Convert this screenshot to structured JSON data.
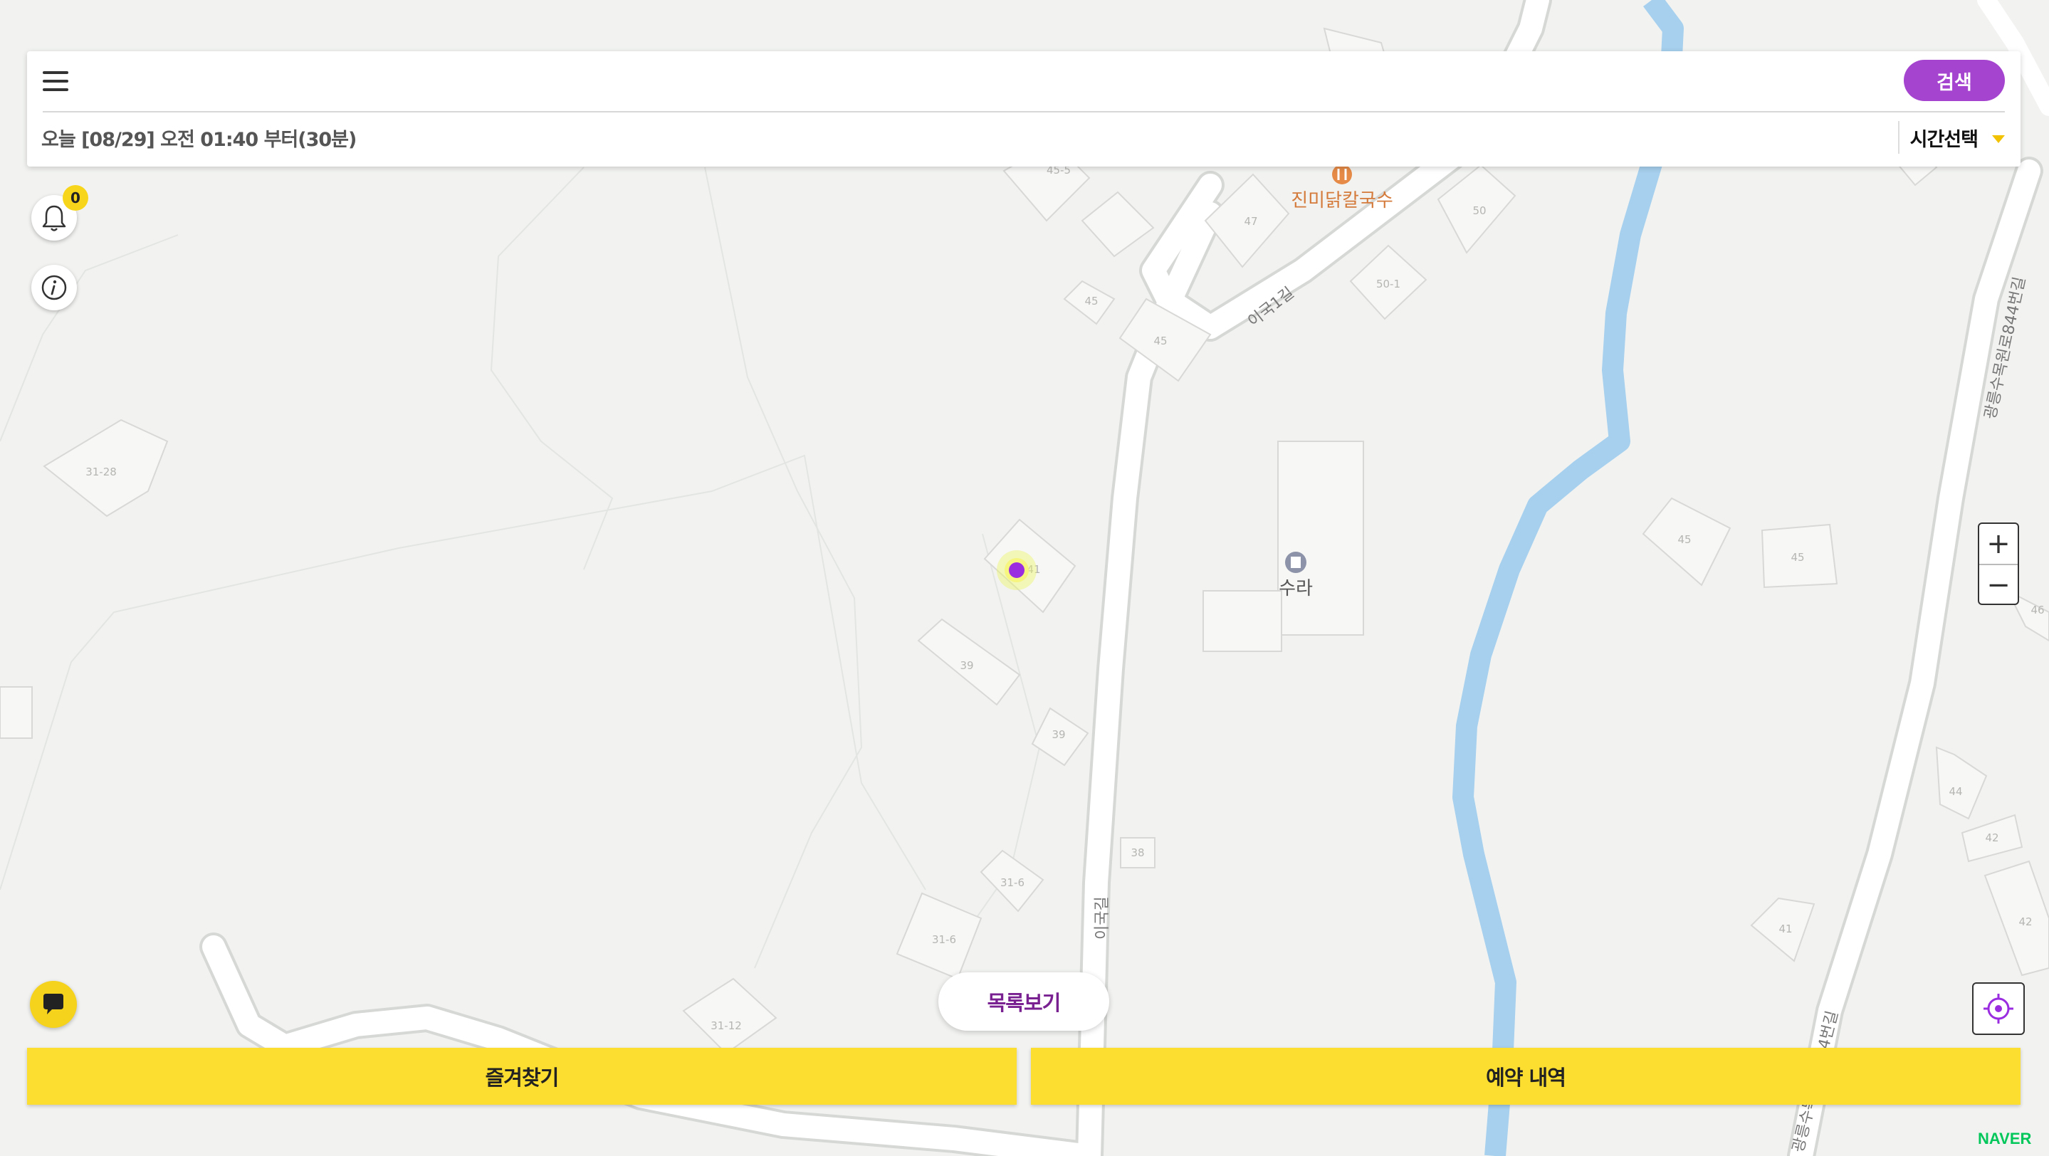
{
  "header": {
    "search_label": "검색",
    "time_text": "오늘 [08/29] 오전 01:40 부터(30분)",
    "time_select_label": "시간선택"
  },
  "notifications": {
    "count": "0"
  },
  "map": {
    "pois": [
      {
        "name": "진미닭칼국수",
        "icon": "restaurant-icon"
      },
      {
        "name": "수라",
        "icon": "building-icon"
      }
    ],
    "roads": [
      "이국1길",
      "이국길",
      "광릉수목원로844번길",
      "광릉수목원로844번길"
    ],
    "building_numbers": [
      "45-5",
      "47",
      "50",
      "50-1",
      "45",
      "45",
      "31-28",
      "41",
      "39",
      "39",
      "38",
      "31-6",
      "31-6",
      "31-12",
      "45",
      "45",
      "46",
      "44",
      "42",
      "42",
      "41"
    ],
    "colors": {
      "river": "#a6d0ee",
      "poi_food": "#e58a47",
      "marker": "#9a2de0",
      "marker_glow": "#ecf56a"
    }
  },
  "buttons": {
    "list_view": "목록보기",
    "favorites": "즐겨찾기",
    "reservations": "예약 내역",
    "zoom_in": "+",
    "zoom_out": "−"
  },
  "brand": {
    "naver": "NAVER"
  },
  "colors": {
    "accent": "#a544cf",
    "primary_button": "#fbde2f",
    "list_text": "#7a2191"
  }
}
